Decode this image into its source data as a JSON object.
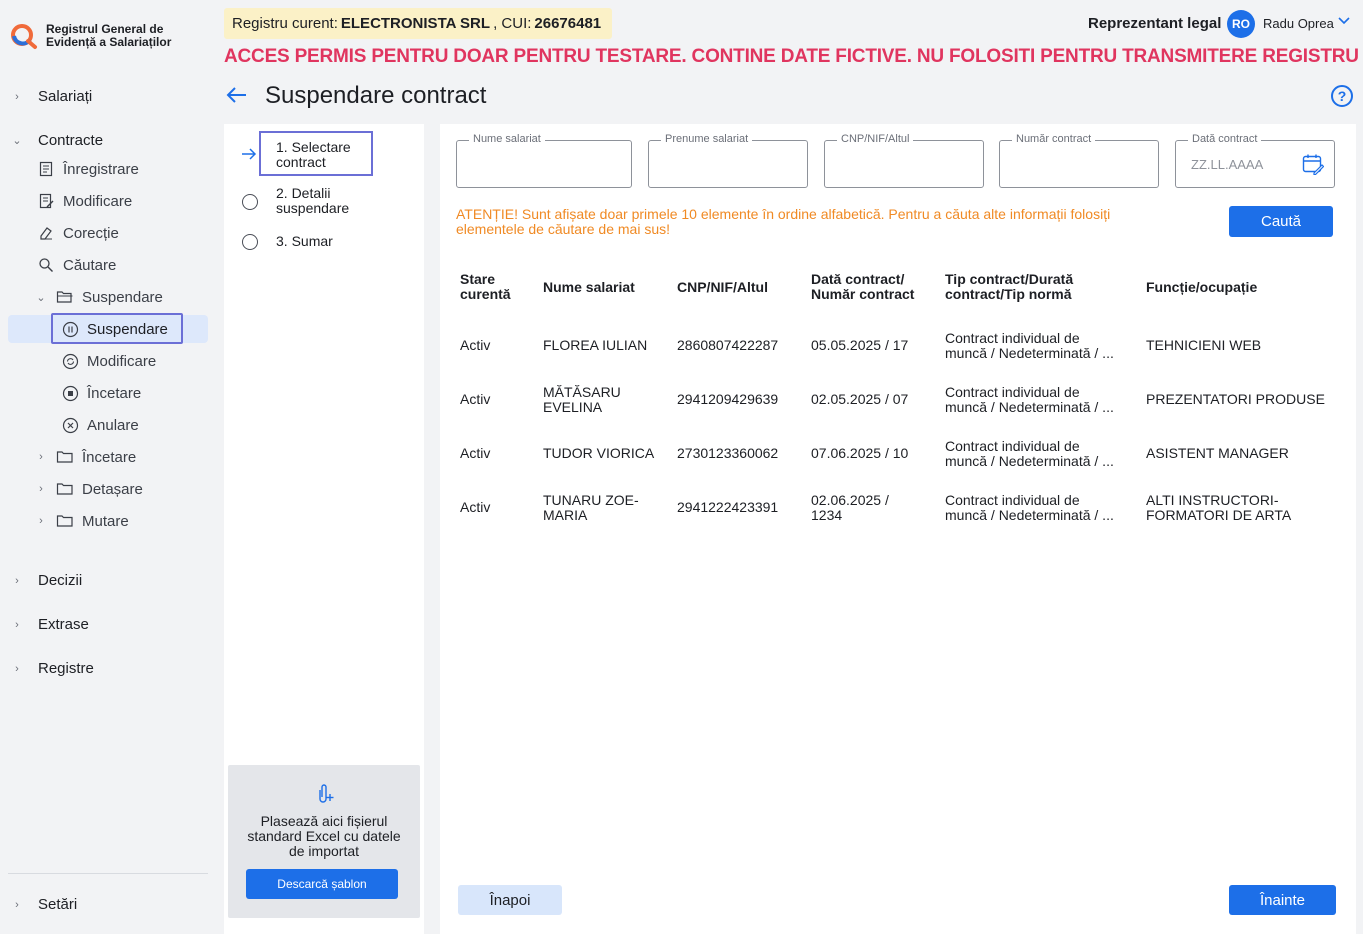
{
  "app": {
    "logo_line1": "Registrul General de",
    "logo_line2": "Evidență a Salariaților"
  },
  "sidebar": {
    "salariati": "Salariați",
    "contracte": "Contracte",
    "inregistrare": "Înregistrare",
    "modificare": "Modificare",
    "corectie": "Corecție",
    "cautare": "Căutare",
    "suspendare_folder": "Suspendare",
    "suspendare_active": "Suspendare",
    "modificare_sub": "Modificare",
    "incetare_sub": "Încetare",
    "anulare": "Anulare",
    "incetare_folder": "Încetare",
    "detasare": "Detașare",
    "mutare": "Mutare",
    "decizii": "Decizii",
    "extrase": "Extrase",
    "registre": "Registre",
    "setari": "Setări"
  },
  "header": {
    "registru_prefix": "Registru curent:",
    "registru_company": "ELECTRONISTA SRL",
    "registru_cui_label": ", CUI:",
    "registru_cui": "26676481",
    "rep_legal": "Reprezentant legal",
    "avatar_initials": "RO",
    "user_name": "Radu Oprea",
    "warning": "ACCES PERMIS PENTRU DOAR PENTRU TESTARE. CONTINE DATE FICTIVE. NU FOLOSITI PENTRU TRANSMITERE REGISTRU",
    "page_title": "Suspendare contract"
  },
  "steps": {
    "step1_line1": "1. Selectare",
    "step1_line2": "contract",
    "step2_line1": "2. Detalii",
    "step2_line2": "suspendare",
    "step3": "3. Sumar"
  },
  "upload": {
    "text": "Plasează aici fișierul standard Excel cu datele de importat",
    "button": "Descarcă șablon"
  },
  "filters": {
    "nume": "Nume salariat",
    "prenume": "Prenume salariat",
    "cnp": "CNP/NIF/Altul",
    "numar": "Număr contract",
    "data": "Dată contract",
    "data_placeholder": "ZZ.LL.AAAA"
  },
  "notice": "ATENȚIE! Sunt afișate doar primele 10 elemente în ordine alfabetică. Pentru a căuta alte informații folosiți elementele de căutare de mai sus!",
  "search_button": "Caută",
  "table": {
    "headers": {
      "stare_l1": "Stare",
      "stare_l2": "curentă",
      "nume": "Nume salariat",
      "cnp": "CNP/NIF/Altul",
      "data_l1": "Dată contract/",
      "data_l2": "Număr contract",
      "tip_l1": "Tip contract/Durată",
      "tip_l2": "contract/Tip normă",
      "functie": "Funcție/ocupație"
    },
    "rows": [
      {
        "stare": "Activ",
        "nume_l1": "FLOREA IULIAN",
        "nume_l2": "",
        "cnp": "2860807422287",
        "data_l1": "05.05.2025 / 17",
        "data_l2": "",
        "tip_l1": "Contract individual de",
        "tip_l2": "muncă / Nedeterminată / ...",
        "functie_l1": "TEHNICIENI WEB",
        "functie_l2": ""
      },
      {
        "stare": "Activ",
        "nume_l1": "MĂTĂSARU",
        "nume_l2": "EVELINA",
        "cnp": "2941209429639",
        "data_l1": "02.05.2025 / 07",
        "data_l2": "",
        "tip_l1": "Contract individual de",
        "tip_l2": "muncă / Nedeterminată / ...",
        "functie_l1": "PREZENTATORI PRODUSE",
        "functie_l2": ""
      },
      {
        "stare": "Activ",
        "nume_l1": "TUDOR VIORICA",
        "nume_l2": "",
        "cnp": "2730123360062",
        "data_l1": "07.06.2025 / 10",
        "data_l2": "",
        "tip_l1": "Contract individual de",
        "tip_l2": "muncă / Nedeterminată / ...",
        "functie_l1": "ASISTENT MANAGER",
        "functie_l2": ""
      },
      {
        "stare": "Activ",
        "nume_l1": "TUNARU ZOE-",
        "nume_l2": "MARIA",
        "cnp": "2941222423391",
        "data_l1": "02.06.2025 /",
        "data_l2": "1234",
        "tip_l1": "Contract individual de",
        "tip_l2": "muncă / Nedeterminată / ...",
        "functie_l1": "ALTI INSTRUCTORI-",
        "functie_l2": "FORMATORI DE ARTA"
      }
    ]
  },
  "footer": {
    "back": "Înapoi",
    "next": "Înainte"
  },
  "colors": {
    "primary": "#1d6fe8",
    "warning_red": "#e0355f",
    "notice_orange": "#f08a24",
    "focus_outline": "#6b6fd6"
  }
}
